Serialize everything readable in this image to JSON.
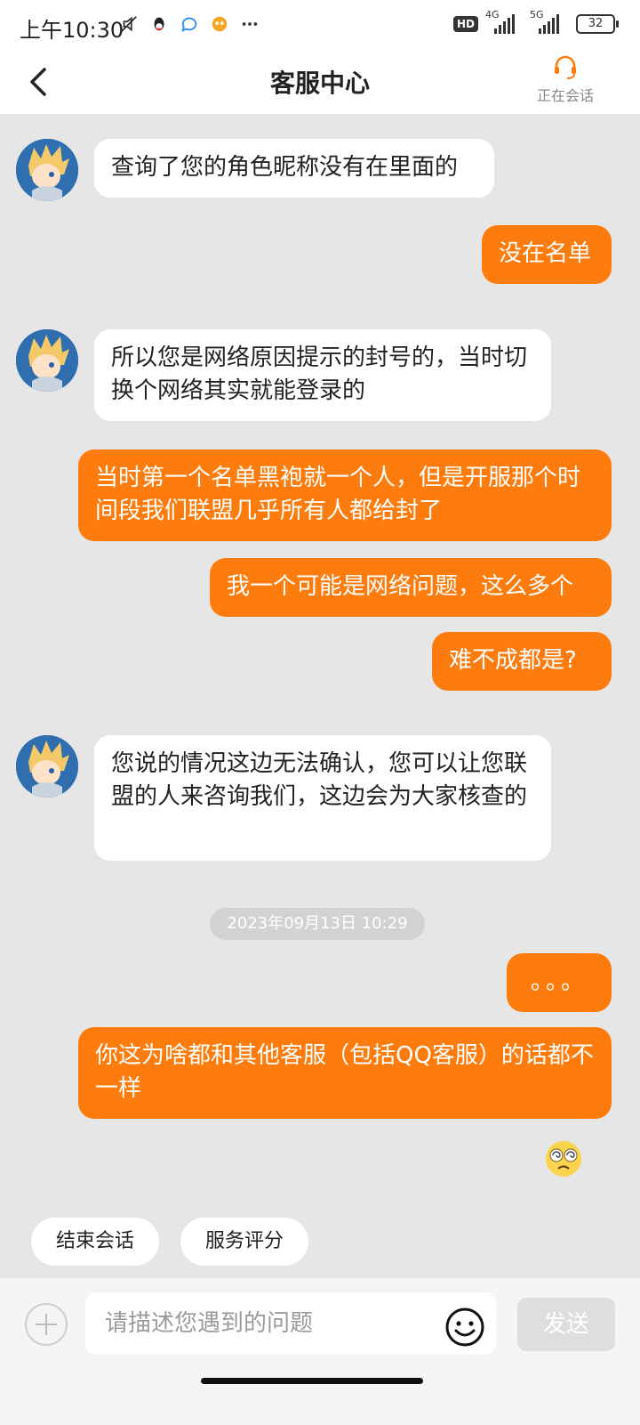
{
  "status_bar": {
    "time": "上午10:30",
    "network_a": "4G",
    "network_b": "5G",
    "hd": "HD",
    "battery": "32"
  },
  "header": {
    "title": "客服中心",
    "agent_status": "正在会话"
  },
  "messages": [
    {
      "from": "agent",
      "text": "查询了您的角色昵称没有在里面的"
    },
    {
      "from": "user",
      "text": "没在名单"
    },
    {
      "from": "agent",
      "text": "所以您是网络原因提示的封号的，当时切换个网络其实就能登录的"
    },
    {
      "from": "user",
      "text": "当时第一个名单黑袍就一个人，但是开服那个时间段我们联盟几乎所有人都给封了"
    },
    {
      "from": "user",
      "text": "我一个可能是网络问题，这么多个"
    },
    {
      "from": "user",
      "text": "难不成都是?"
    },
    {
      "from": "agent",
      "text": "您说的情况这边无法确认，您可以让您联盟的人来咨询我们，这边会为大家核查的"
    },
    {
      "from": "user",
      "text": "。。。"
    },
    {
      "from": "user",
      "text": "你这为啥都和其他客服（包括QQ客服）的话都不一样"
    }
  ],
  "timestamp": "2023年09月13日 10:29",
  "emoji_message": "dizzy-face-emoji",
  "quick_actions": {
    "end": "结束会话",
    "rate": "服务评分"
  },
  "input": {
    "placeholder": "请描述您遇到的问题",
    "send": "发送"
  },
  "colors": {
    "accent": "#fe7c0e",
    "background": "#e6e6e6"
  }
}
